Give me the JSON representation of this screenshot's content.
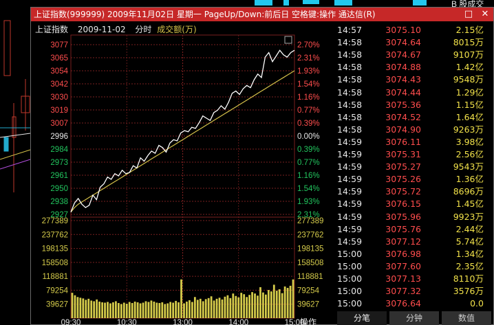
{
  "background_window": {
    "b_share_label": "B 股成交"
  },
  "window": {
    "title": "上证指数(999999)  2009年11月02日  星期一  PageUp/Down:前后日  空格键:操作  通达信(R)",
    "minimize_glyph": "□",
    "close_glyph": "✕",
    "title_bg": "#c62828"
  },
  "chart": {
    "header": {
      "index_name": "上证指数",
      "date": "2009-11-02",
      "mode": "分时",
      "indicator": "成交额(万)"
    },
    "price_labels": [
      "3077",
      "3065",
      "3054",
      "3042",
      "3030",
      "3019",
      "3007",
      "2996",
      "2984",
      "2973",
      "2961",
      "2950",
      "2938",
      "2927"
    ],
    "pct_labels": [
      "2.70%",
      "2.31%",
      "1.93%",
      "1.54%",
      "1.16%",
      "0.77%",
      "0.39%",
      "0.00%",
      "0.39%",
      "0.77%",
      "1.16%",
      "1.54%",
      "1.93%",
      "2.31%"
    ],
    "volume_labels": [
      "277389",
      "237762",
      "198135",
      "158508",
      "118881",
      "79254",
      "39627"
    ],
    "time_labels": [
      "09:30",
      "10:30",
      "13:00",
      "14:00",
      "15:00"
    ],
    "action_label": "操作",
    "colors": {
      "up": "#ff4d4d",
      "down": "#22c55e",
      "flat": "#e8e8e8",
      "volume": "#d6cc4b",
      "avg": "#d6c24a",
      "grid": "#7a1f1f"
    }
  },
  "chart_data": {
    "type": "line",
    "x_range": [
      "09:30",
      "15:00"
    ],
    "ylim": [
      2927,
      3077
    ],
    "prev_close": 2996,
    "series": [
      {
        "values": [
          2929,
          2937,
          2941,
          2936,
          2933,
          2935,
          2944,
          2940,
          2951,
          2954,
          2960,
          2958,
          2963,
          2961,
          2966,
          2963,
          2964,
          2970,
          2968,
          2977,
          2974,
          2979,
          2983,
          2981,
          2988,
          2986,
          2982,
          2990,
          2993,
          2992,
          2999,
          3001,
          3000,
          3004,
          3003,
          3008,
          3014,
          3012,
          3010,
          3017,
          3019,
          3023,
          3020,
          3026,
          3034,
          3036,
          3033,
          3038,
          3041,
          3039,
          3046,
          3051,
          3048,
          3066,
          3070,
          3062,
          3067,
          3072,
          3068,
          3066,
          3070,
          3072
        ]
      },
      {
        "values": [
          2929,
          2933,
          2936,
          2938,
          2940,
          2942,
          2944,
          2946,
          2948,
          2950,
          2952,
          2954,
          2956,
          2958,
          2960,
          2962,
          2964,
          2966,
          2968,
          2970,
          2972,
          2974,
          2976,
          2978,
          2980,
          2982,
          2984,
          2986,
          2988,
          2990,
          2992,
          2994,
          2996,
          2998,
          3000,
          3002,
          3004,
          3006,
          3008,
          3010,
          3012,
          3014,
          3016,
          3018,
          3020,
          3022,
          3024,
          3026,
          3028,
          3030,
          3032,
          3034,
          3036,
          3038,
          3040,
          3042,
          3044,
          3046,
          3048,
          3050,
          3052,
          3054
        ]
      }
    ],
    "volume": {
      "ylim": [
        0,
        277389
      ],
      "values": [
        72000,
        65000,
        60000,
        58000,
        56000,
        52000,
        55000,
        50000,
        48000,
        53000,
        47000,
        45000,
        44000,
        46000,
        42000,
        45000,
        48000,
        43000,
        40000,
        44000,
        41000,
        46000,
        43000,
        47000,
        45000,
        42000,
        44000,
        48000,
        46000,
        50000,
        47000,
        44000,
        43000,
        45000,
        40000,
        42000,
        46000,
        44000,
        49000,
        45000,
        110000,
        42000,
        47000,
        51000,
        46000,
        60000,
        52000,
        55000,
        48000,
        54000,
        57000,
        62000,
        50000,
        55000,
        58000,
        53000,
        61000,
        65000,
        57000,
        70000,
        63000,
        59000,
        72000,
        68000,
        60000,
        66000,
        74000,
        70000,
        64000,
        88000,
        73000,
        67000,
        80000,
        76000,
        95000,
        78000,
        82000,
        71000,
        90000,
        86000,
        92000,
        110000
      ]
    }
  },
  "ticks": {
    "rows": [
      [
        "14:57",
        "3075.10",
        "2.15亿"
      ],
      [
        "14:58",
        "3074.64",
        "8015万"
      ],
      [
        "14:58",
        "3074.67",
        "9107万"
      ],
      [
        "14:58",
        "3074.88",
        "1.42亿"
      ],
      [
        "14:58",
        "3074.43",
        "9548万"
      ],
      [
        "14:58",
        "3074.44",
        "1.29亿"
      ],
      [
        "14:58",
        "3075.36",
        "1.15亿"
      ],
      [
        "14:58",
        "3074.52",
        "1.64亿"
      ],
      [
        "14:58",
        "3074.90",
        "9263万"
      ],
      [
        "14:59",
        "3076.11",
        "3.98亿"
      ],
      [
        "14:59",
        "3075.31",
        "2.56亿"
      ],
      [
        "14:59",
        "3075.27",
        "9543万"
      ],
      [
        "14:59",
        "3075.26",
        "1.36亿"
      ],
      [
        "14:59",
        "3075.72",
        "8696万"
      ],
      [
        "14:59",
        "3076.15",
        "1.45亿"
      ],
      [
        "14:59",
        "3075.96",
        "9923万"
      ],
      [
        "14:59",
        "3075.76",
        "2.44亿"
      ],
      [
        "14:59",
        "3077.12",
        "5.74亿"
      ],
      [
        "15:00",
        "3076.98",
        "1.34亿"
      ],
      [
        "15:00",
        "3077.60",
        "2.35亿"
      ],
      [
        "15:00",
        "3077.13",
        "8110万"
      ],
      [
        "15:00",
        "3077.32",
        "3576万"
      ],
      [
        "15:00",
        "3076.64",
        "0.0"
      ]
    ]
  },
  "tabs": {
    "ticks": "分笔",
    "minute": "分钟",
    "data": "数值"
  }
}
